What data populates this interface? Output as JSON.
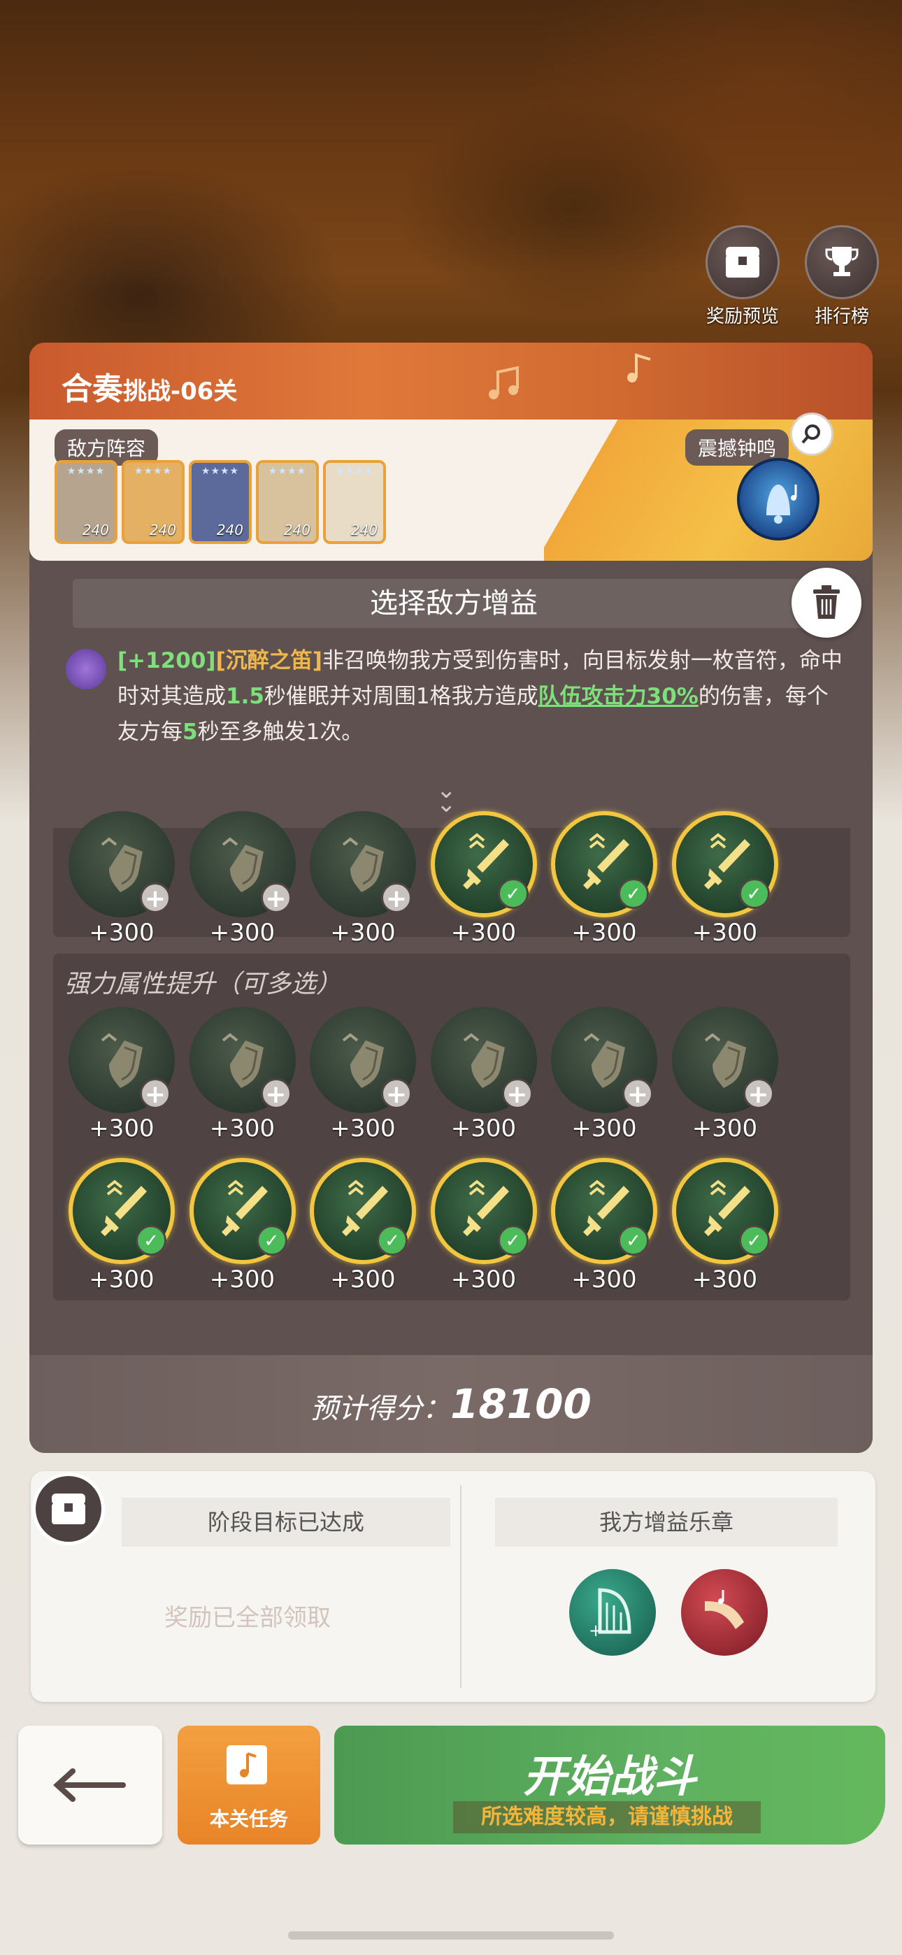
{
  "top_buttons": [
    {
      "label": "奖励预览",
      "icon": "chest-icon"
    },
    {
      "label": "排行榜",
      "icon": "trophy-icon"
    }
  ],
  "panel": {
    "title_main": "合奏",
    "title_sub": "挑战-06关",
    "enemy_label": "敌方阵容",
    "enemy_heroes": [
      {
        "level": "240",
        "color": "#b7a48e"
      },
      {
        "level": "240",
        "color": "#e3b064"
      },
      {
        "level": "240",
        "color": "#5b6a9a"
      },
      {
        "level": "240",
        "color": "#d8c29e"
      },
      {
        "level": "240",
        "color": "#e8dcc6"
      }
    ],
    "bell_label": "震撼钟鸣"
  },
  "buff_select": {
    "header": "选择敌方增益",
    "desc": {
      "bonus": "[+1200]",
      "name": "[沉醉之笛]",
      "t1": "非召唤物我方受到伤害时，向目标发射一枚音符，命中时对其造成",
      "v1": "1.5",
      "t2": "秒催眠并对周围",
      "v2": "1",
      "t3": "格我方造成",
      "link": "队伍攻击力30%",
      "t4": "的伤害，每个友方每",
      "v3": "5",
      "t5": "秒至多触发",
      "v4": "1",
      "t6": "次。"
    },
    "row1": [
      {
        "value": "+300",
        "on": false
      },
      {
        "value": "+300",
        "on": false
      },
      {
        "value": "+300",
        "on": false
      },
      {
        "value": "+300",
        "on": true
      },
      {
        "value": "+300",
        "on": true
      },
      {
        "value": "+300",
        "on": true
      }
    ],
    "strong_title": "强力属性提升（可多选）",
    "row2": [
      {
        "value": "+300",
        "on": false
      },
      {
        "value": "+300",
        "on": false
      },
      {
        "value": "+300",
        "on": false
      },
      {
        "value": "+300",
        "on": false
      },
      {
        "value": "+300",
        "on": false
      },
      {
        "value": "+300",
        "on": false
      }
    ],
    "row3": [
      {
        "value": "+300",
        "on": true
      },
      {
        "value": "+300",
        "on": true
      },
      {
        "value": "+300",
        "on": true
      },
      {
        "value": "+300",
        "on": true
      },
      {
        "value": "+300",
        "on": true
      },
      {
        "value": "+300",
        "on": true
      }
    ],
    "score_label": "预计得分：",
    "score_value": "18100"
  },
  "bottom": {
    "goal_title": "阶段目标已达成",
    "claimed": "奖励已全部领取",
    "our_title": "我方增益乐章"
  },
  "actions": {
    "task": "本关任务",
    "start": "开始战斗",
    "warning": "所选难度较高，请谨慎挑战"
  }
}
